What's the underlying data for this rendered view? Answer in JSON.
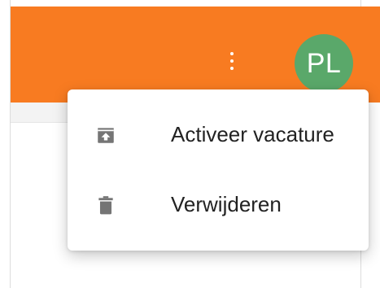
{
  "header": {
    "avatar_initials": "PL",
    "more_icon": "more-vert-icon",
    "accent_color": "#f87b21",
    "avatar_color": "#5aa86a"
  },
  "menu": {
    "items": [
      {
        "label": "Activeer vacature",
        "icon": "unarchive-icon"
      },
      {
        "label": "Verwijderen",
        "icon": "delete-icon"
      }
    ]
  }
}
